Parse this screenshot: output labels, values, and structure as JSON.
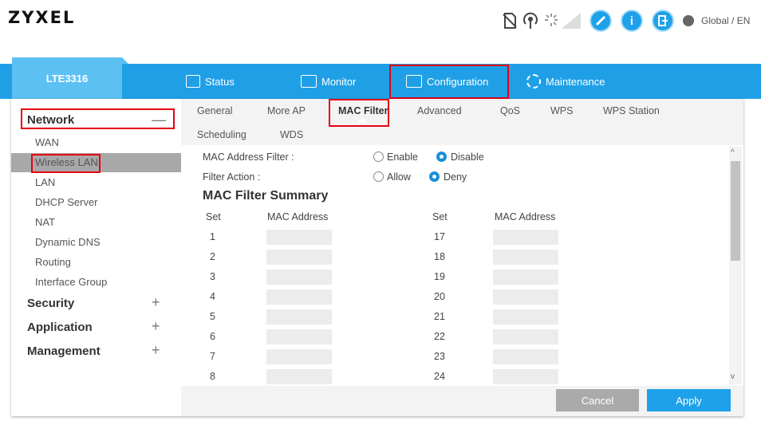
{
  "header": {
    "logo": "ZYXEL",
    "language": "Global / EN",
    "icons": [
      "sim-icon",
      "signal-icon",
      "loading-icon",
      "signal-bars-icon",
      "wizard-icon",
      "info-icon",
      "logout-icon",
      "globe-icon"
    ],
    "info_glyph": "i"
  },
  "nav": {
    "device": "LTE3316",
    "items": [
      {
        "label": "Status",
        "icon": "status-icon"
      },
      {
        "label": "Monitor",
        "icon": "monitor-icon"
      },
      {
        "label": "Configuration",
        "icon": "configuration-icon"
      },
      {
        "label": "Maintenance",
        "icon": "gear-icon"
      }
    ],
    "accent": "#1fa0e6"
  },
  "sidebar": {
    "sections": [
      {
        "label": "Network",
        "sign": "—"
      },
      {
        "label": "Security",
        "sign": "+"
      },
      {
        "label": "Application",
        "sign": "+"
      },
      {
        "label": "Management",
        "sign": "+"
      }
    ],
    "network_items": [
      "WAN",
      "Wireless LAN",
      "LAN",
      "DHCP Server",
      "NAT",
      "Dynamic DNS",
      "Routing",
      "Interface Group"
    ],
    "active": "Wireless LAN"
  },
  "subtabs": [
    "General",
    "More AP",
    "MAC Filter",
    "Advanced",
    "QoS",
    "WPS",
    "WPS Station",
    "Scheduling",
    "WDS"
  ],
  "active_subtab": "MAC Filter",
  "form": {
    "mac_filter_label": "MAC Address Filter :",
    "enable": "Enable",
    "disable": "Disable",
    "mac_filter_value": "Disable",
    "filter_action_label": "Filter Action :",
    "allow": "Allow",
    "deny": "Deny",
    "filter_action_value": "Deny"
  },
  "summary": {
    "title": "MAC Filter Summary",
    "col_set": "Set",
    "col_mac": "MAC Address",
    "left_sets": [
      "1",
      "2",
      "3",
      "4",
      "5",
      "6",
      "7",
      "8"
    ],
    "right_sets": [
      "17",
      "18",
      "19",
      "20",
      "21",
      "22",
      "23",
      "24"
    ],
    "left_macs": [
      "",
      "",
      "",
      "",
      "",
      "",
      "",
      ""
    ],
    "right_macs": [
      "",
      "",
      "",
      "",
      "",
      "",
      "",
      ""
    ]
  },
  "buttons": {
    "cancel": "Cancel",
    "apply": "Apply"
  },
  "scroll": {
    "up": "^",
    "down": "v"
  }
}
